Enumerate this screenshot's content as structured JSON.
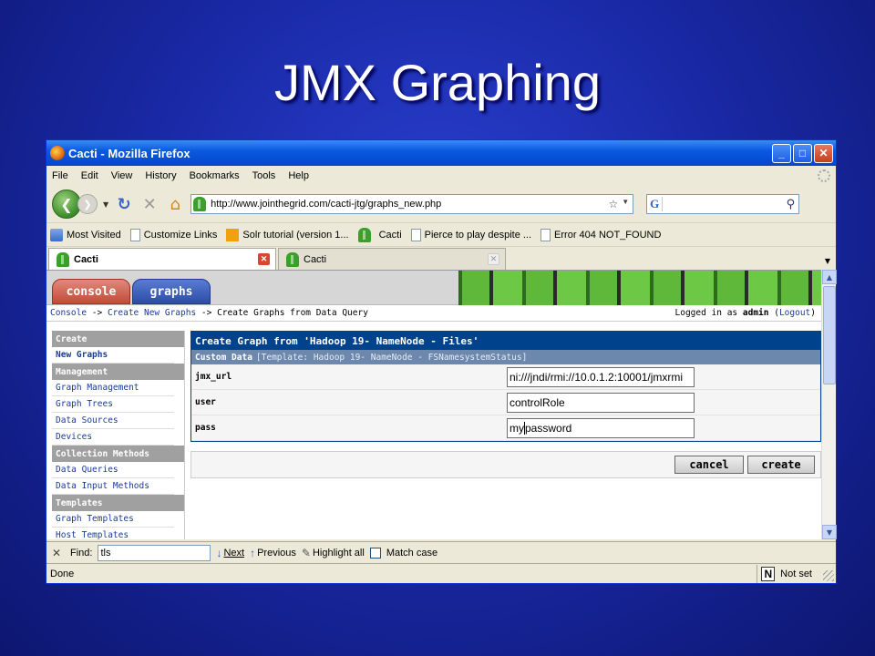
{
  "slide": {
    "title": "JMX Graphing"
  },
  "window": {
    "title": "Cacti - Mozilla Firefox",
    "controls": {
      "minimize": "_",
      "maximize": "□",
      "close": "✕"
    }
  },
  "menu": [
    "File",
    "Edit",
    "View",
    "History",
    "Bookmarks",
    "Tools",
    "Help"
  ],
  "nav": {
    "url": "http://www.jointhegrid.com/cacti-jtg/graphs_new.php",
    "search_engine": "G",
    "search_value": ""
  },
  "bookmarks": [
    "Most Visited",
    "Customize Links",
    "Solr tutorial (version 1...",
    "Cacti",
    "Pierce to play despite ...",
    "Error 404 NOT_FOUND"
  ],
  "tabs": [
    {
      "label": "Cacti",
      "active": true
    },
    {
      "label": "Cacti",
      "active": false
    }
  ],
  "cacti": {
    "tabs": {
      "console": "console",
      "graphs": "graphs"
    },
    "breadcrumb": {
      "console": "Console",
      "sep1": " -> ",
      "create_new": "Create New Graphs",
      "sep2": " -> ",
      "current": "Create Graphs from Data Query"
    },
    "login": {
      "prefix": "Logged in as ",
      "user": "admin",
      "open": " (",
      "logout": "Logout",
      "close": ")"
    },
    "sidebar": [
      {
        "type": "head",
        "label": "Create"
      },
      {
        "type": "item",
        "label": "New Graphs",
        "current": true
      },
      {
        "type": "head",
        "label": "Management"
      },
      {
        "type": "item",
        "label": "Graph Management"
      },
      {
        "type": "item",
        "label": "Graph Trees"
      },
      {
        "type": "item",
        "label": "Data Sources"
      },
      {
        "type": "item",
        "label": "Devices"
      },
      {
        "type": "head",
        "label": "Collection Methods"
      },
      {
        "type": "item",
        "label": "Data Queries"
      },
      {
        "type": "item",
        "label": "Data Input Methods"
      },
      {
        "type": "head",
        "label": "Templates"
      },
      {
        "type": "item",
        "label": "Graph Templates"
      },
      {
        "type": "item",
        "label": "Host Templates"
      }
    ],
    "form": {
      "title": "Create Graph from 'Hadoop 19- NameNode - Files'",
      "sub_bold": "Custom Data",
      "sub_template": "[Template: Hadoop 19- NameNode - FSNamesystemStatus]",
      "fields": [
        {
          "label": "jmx_url",
          "value": "ni:///jndi/rmi://10.0.1.2:10001/jmxrmi"
        },
        {
          "label": "user",
          "value": "controlRole"
        },
        {
          "label": "pass",
          "value_before_cursor": "my",
          "value_after_cursor": "password"
        }
      ]
    },
    "buttons": {
      "cancel": "cancel",
      "create": "create"
    }
  },
  "findbar": {
    "label": "Find:",
    "value": "tls",
    "next": "Next",
    "previous": "Previous",
    "highlight": "Highlight all",
    "match_case": "Match case"
  },
  "status": {
    "text": "Done",
    "noscript": "N",
    "right_text": "Not set"
  }
}
